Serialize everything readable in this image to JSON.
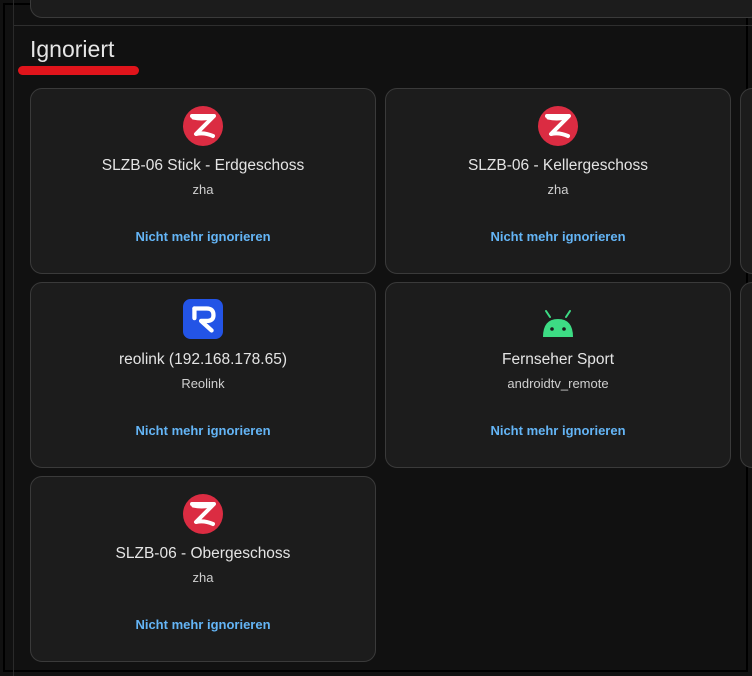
{
  "section": {
    "title": "Ignoriert"
  },
  "action_label": "Nicht mehr ignorieren",
  "colors": {
    "zigbee_red": "#db2c42",
    "reolink_blue": "#2354e6",
    "android_green": "#3ddc84",
    "link_blue": "#64b5f6"
  },
  "cards": [
    {
      "title": "SLZB-06 Stick - Erdgeschoss",
      "subtitle": "zha",
      "icon": "zigbee-icon"
    },
    {
      "title": "SLZB-06 - Kellergeschoss",
      "subtitle": "zha",
      "icon": "zigbee-icon"
    },
    {
      "title": "reolink (192.168.178.65)",
      "subtitle": "Reolink",
      "icon": "reolink-icon"
    },
    {
      "title": "Fernseher Sport",
      "subtitle": "androidtv_remote",
      "icon": "android-icon"
    },
    {
      "title": "SLZB-06 - Obergeschoss",
      "subtitle": "zha",
      "icon": "zigbee-icon"
    }
  ]
}
